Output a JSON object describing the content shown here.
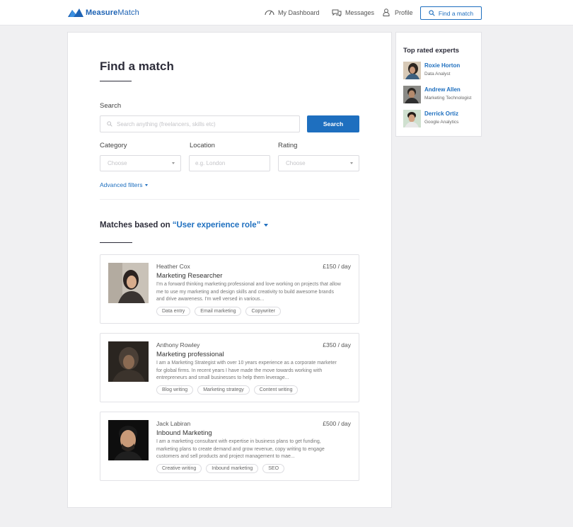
{
  "brand": {
    "name_bold": "Measure",
    "name_rest": "Match",
    "color": "#1e63b4"
  },
  "nav": {
    "dashboard": {
      "label": "My Dashboard",
      "icon": "dashboard-gauge-icon"
    },
    "messages": {
      "label": "Messages",
      "icon": "chat-bubbles-icon"
    },
    "profile": {
      "label": "Profile",
      "icon": "person-icon"
    },
    "find_match": {
      "label": "Find a match",
      "icon": "search-icon"
    }
  },
  "main": {
    "title": "Find a match",
    "search": {
      "label": "Search",
      "placeholder": "Search anything (freelancers, skills etc)",
      "button": "Search"
    },
    "filters": {
      "category": {
        "label": "Category",
        "value": "Choose"
      },
      "location": {
        "label": "Location",
        "placeholder": "e.g. London"
      },
      "rating": {
        "label": "Rating",
        "value": "Choose"
      }
    },
    "advanced_filters": "Advanced filters",
    "matches": {
      "prefix": "Matches based on",
      "query": "“User experience role”"
    },
    "results": [
      {
        "name": "Heather Cox",
        "rate": "£150 / day",
        "role": "Marketing Researcher",
        "description": "I'm a forward thinking marketing professional and love working on projects that allow me to use my marketing and design skills and creativity to build awesome brands and drive awareness. I'm well versed in various...",
        "tags": [
          "Data entry",
          "Email marketing",
          "Copywriter"
        ]
      },
      {
        "name": "Anthony Rowley",
        "rate": "£350  / day",
        "role": "Marketing professional",
        "description": "I am a Marketing Strategist with over 10 years experience as a corporate marketer for global firms. In recent years I have made the move towards working with entrepreneurs and small businesses to help them leverage...",
        "tags": [
          "Blog writing",
          "Marketing strategy",
          "Content writing"
        ]
      },
      {
        "name": "Jack Labiran",
        "rate": "£500 / day",
        "role": "Inbound Marketing",
        "description": "I am a marketing consultant with expertise in business plans to get funding, marketing plans to create demand and grow revenue, copy writing to engage customers and sell products and project management to mae...",
        "tags": [
          "Creative writing",
          "Inbound marketing",
          "SEO"
        ]
      }
    ]
  },
  "sidebar": {
    "title": "Top rated experts",
    "experts": [
      {
        "name": "Roxie Horton",
        "title": "Data Analyst"
      },
      {
        "name": "Andrew Allen",
        "title": "Marketing Technologist"
      },
      {
        "name": "Derrick Ortiz",
        "title": "Google Analytics"
      }
    ]
  },
  "colors": {
    "accent": "#1e6fbf",
    "background": "#f0f0f2",
    "heading": "#2d2d3a"
  }
}
